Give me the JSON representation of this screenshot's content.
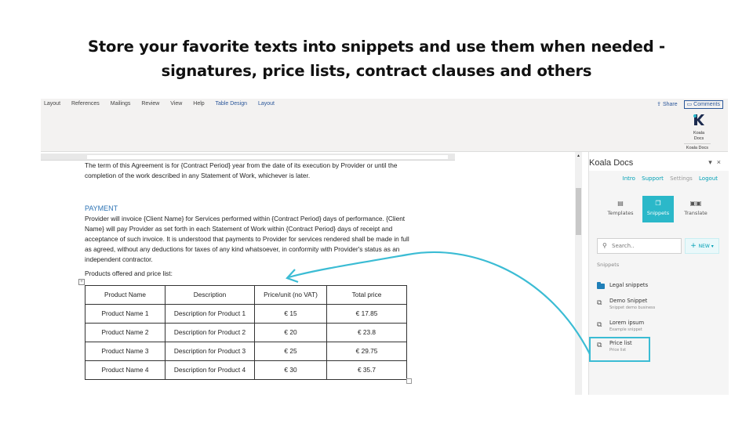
{
  "headline": {
    "line1": "Store your favorite texts into snippets and use them when needed -",
    "line2": "signatures, price lists, contract clauses and others"
  },
  "ribbon": {
    "tabs": [
      "Layout",
      "References",
      "Mailings",
      "Review",
      "View",
      "Help",
      "Table Design",
      "Layout"
    ],
    "share_label": "Share",
    "comments_label": "Comments",
    "addin_label_1": "Koala",
    "addin_label_2": "Docs",
    "group_label": "Koala Docs"
  },
  "document": {
    "p1": "The term of this Agreement is for {Contract Period} year from the date of its execution by Provider or until the completion of the work described in any Statement of Work, whichever is later.",
    "heading": "PAYMENT",
    "p2": "Provider will invoice {Client Name} for Services performed within {Contract Period} days of performance. {Client Name} will pay Provider as set forth in each Statement of Work within {Contract Period} days of receipt and acceptance of such invoice. It is understood that payments to Provider for services rendered shall be made in full as agreed, without any deductions for taxes of any kind whatsoever, in conformity with Provider's status as an independent contractor.",
    "p3": "Products offered and price list:",
    "table": {
      "headers": [
        "Product Name",
        "Description",
        "Price/unit (no VAT)",
        "Total price"
      ],
      "rows": [
        [
          "Product Name 1",
          "Description for Product 1",
          "€ 15",
          "€ 17.85"
        ],
        [
          "Product Name 2",
          "Description for Product 2",
          "€ 20",
          "€ 23.8"
        ],
        [
          "Product Name 3",
          "Description for Product 3",
          "€ 25",
          "€ 29.75"
        ],
        [
          "Product Name 4",
          "Description for Product 4",
          "€ 30",
          "€ 35.7"
        ]
      ]
    }
  },
  "pane": {
    "title": "Koala Docs",
    "links": [
      "Intro",
      "Support",
      "Settings",
      "Logout"
    ],
    "buttons": [
      {
        "label": "Templates",
        "icon": "document-icon"
      },
      {
        "label": "Snippets",
        "icon": "snippets-icon"
      },
      {
        "label": "Translate",
        "icon": "translate-icon"
      }
    ],
    "search_placeholder": "Search..",
    "new_label": "NEW",
    "section_label": "Snippets",
    "folder": "Legal snippets",
    "items": [
      {
        "title": "Demo Snippet",
        "subtitle": "Snippet demo business"
      },
      {
        "title": "Lorem ipsum",
        "subtitle": "Example snippet"
      },
      {
        "title": "Price list",
        "subtitle": "Price list"
      }
    ],
    "accent": "#2bb8c9"
  }
}
